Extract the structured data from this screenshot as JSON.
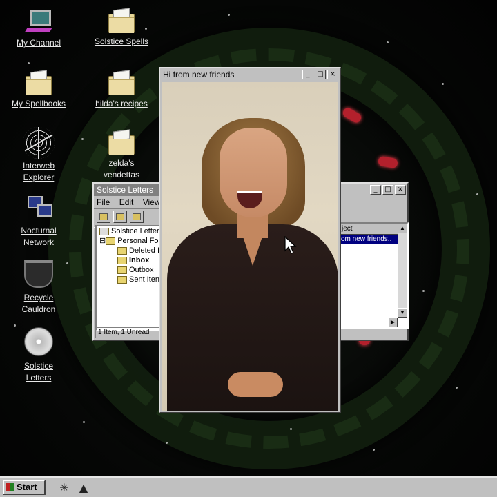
{
  "desktop": {
    "icons": [
      {
        "label": "My Channel",
        "icon": "computer-icon"
      },
      {
        "label": "Solstice Spells",
        "icon": "folder-icon"
      },
      {
        "label": "My Spellbooks",
        "icon": "folder-icon"
      },
      {
        "label": "hilda's recipes",
        "icon": "folder-icon"
      },
      {
        "label": "Interweb Explorer",
        "label_line1": "Interweb",
        "label_line2": "Explorer",
        "icon": "spiderweb-icon"
      },
      {
        "label": "zelda's vendettas",
        "label_line1": "zelda's",
        "label_line2": "vendettas",
        "icon": "folder-icon"
      },
      {
        "label": "Nocturnal Network",
        "label_line1": "Nocturnal",
        "label_line2": "Network",
        "icon": "network-icon"
      },
      {
        "label": "Recycle Cauldron",
        "label_line1": "Recycle",
        "label_line2": "Cauldron",
        "icon": "cauldron-icon"
      },
      {
        "label": "Solstice Letters",
        "label_line1": "Solstice",
        "label_line2": "Letters",
        "icon": "cd-icon"
      }
    ]
  },
  "mail_window": {
    "title": "Solstice Letters",
    "menu": [
      "File",
      "Edit",
      "View"
    ],
    "tree_root": "Solstice Letter",
    "tree_folder": "Personal Fold",
    "folders": [
      "Deleted I",
      "Inbox",
      "Outbox",
      "Sent Iten"
    ],
    "selected_folder": "Inbox",
    "column_header": "ject",
    "selected_message": "om new friends..",
    "status": "1 Item, 1 Unread"
  },
  "video_window": {
    "title": "Hi from new friends"
  },
  "window_buttons": {
    "minimize": "_",
    "maximize": "□",
    "close": "×"
  },
  "taskbar": {
    "start_label": "Start",
    "quick_launch": [
      "spiderweb-icon",
      "witch-hat-icon"
    ]
  },
  "colors": {
    "window_gray": "#c0c0c0",
    "selection_blue": "#000080",
    "desktop_bg": "#050505",
    "wreath_green": "#12200f"
  }
}
